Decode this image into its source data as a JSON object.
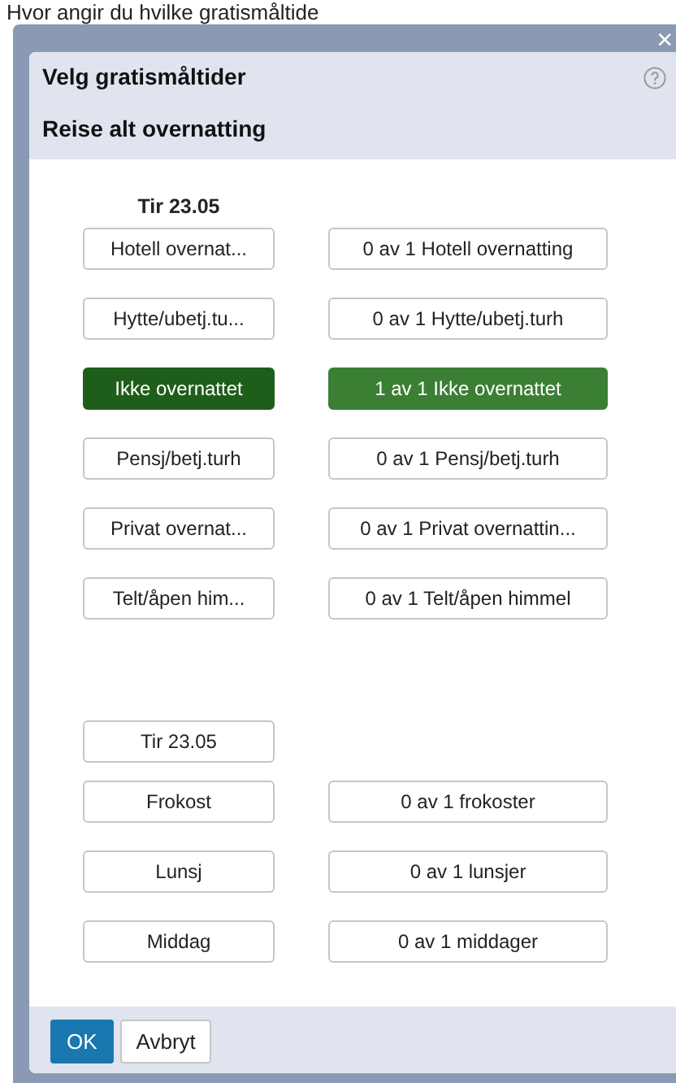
{
  "page_heading": "Hvor angir du hvilke gratismåltide",
  "dialog": {
    "close": "×",
    "title": "Velg gratismåltider",
    "subtitle": "Reise alt overnatting"
  },
  "accommodation": {
    "date": "Tir 23.05",
    "rows": [
      {
        "label": "Hotell overnat...",
        "count": "0 av 1 Hotell overnatting",
        "selected": false
      },
      {
        "label": "Hytte/ubetj.tu...",
        "count": "0 av 1 Hytte/ubetj.turh",
        "selected": false
      },
      {
        "label": "Ikke overnattet",
        "count": "1 av 1 Ikke overnattet",
        "selected": true
      },
      {
        "label": "Pensj/betj.turh",
        "count": "0 av 1 Pensj/betj.turh",
        "selected": false
      },
      {
        "label": "Privat overnat...",
        "count": "0 av 1 Privat overnattin...",
        "selected": false
      },
      {
        "label": "Telt/åpen him...",
        "count": "0 av 1 Telt/åpen himmel",
        "selected": false
      }
    ]
  },
  "meals": {
    "date": "Tir 23.05",
    "rows": [
      {
        "label": "Frokost",
        "count": "0 av 1 frokoster",
        "selected": false
      },
      {
        "label": "Lunsj",
        "count": "0 av 1 lunsjer",
        "selected": false
      },
      {
        "label": "Middag",
        "count": "0 av 1 middager",
        "selected": false
      }
    ]
  },
  "buttons": [
    {
      "label": "OK",
      "kind": "primary"
    },
    {
      "label": "Avbryt",
      "kind": "secondary"
    }
  ]
}
